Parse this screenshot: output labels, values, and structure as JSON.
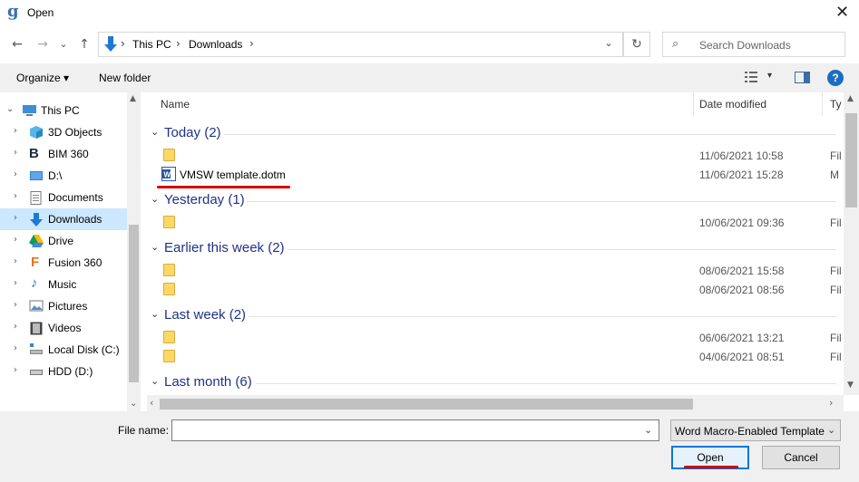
{
  "window": {
    "title": "Open",
    "app_icon": "g",
    "close_glyph": "✕"
  },
  "nav": {
    "back_glyph": "←",
    "forward_glyph": "→",
    "recent_glyph": "⌄",
    "up_glyph": "↑",
    "breadcrumb": [
      "This PC",
      "Downloads"
    ],
    "sep_glyph": "›",
    "dropdown_glyph": "⌄",
    "refresh_glyph": "↻",
    "search_placeholder": "Search Downloads",
    "search_glyph": "⌕"
  },
  "toolbar": {
    "organize": "Organize ▾",
    "new_folder": "New folder",
    "view_dropdown": "▾",
    "help": "?"
  },
  "sidebar": {
    "items": [
      {
        "label": "This PC",
        "icon": "computer-icon",
        "expander": "⌄"
      },
      {
        "label": "3D Objects",
        "icon": "cube-icon",
        "expander": "›"
      },
      {
        "label": "BIM 360",
        "icon": "bim360-icon",
        "expander": "›"
      },
      {
        "label": "D:\\",
        "icon": "drive-icon",
        "expander": "›"
      },
      {
        "label": "Documents",
        "icon": "documents-icon",
        "expander": "›"
      },
      {
        "label": "Downloads",
        "icon": "downloads-icon",
        "expander": "›",
        "selected": true
      },
      {
        "label": "Drive",
        "icon": "google-drive-icon",
        "expander": "›"
      },
      {
        "label": "Fusion 360",
        "icon": "fusion360-icon",
        "expander": "›"
      },
      {
        "label": "Music",
        "icon": "music-icon",
        "expander": "›"
      },
      {
        "label": "Pictures",
        "icon": "pictures-icon",
        "expander": "›"
      },
      {
        "label": "Videos",
        "icon": "videos-icon",
        "expander": "›"
      },
      {
        "label": "Local Disk (C:)",
        "icon": "local-disk-icon",
        "expander": "›"
      },
      {
        "label": "HDD (D:)",
        "icon": "hdd-icon",
        "expander": "›"
      }
    ]
  },
  "columns": {
    "name": "Name",
    "date_modified": "Date modified",
    "type": "Ty"
  },
  "groups": [
    {
      "label": "Today (2)",
      "rows": [
        {
          "name": "",
          "date": "11/06/2021 10:58",
          "type": "Fil",
          "kind": "folder"
        },
        {
          "name": "VMSW template.dotm",
          "date": "11/06/2021 15:28",
          "type": "M",
          "kind": "word"
        }
      ]
    },
    {
      "label": "Yesterday (1)",
      "rows": [
        {
          "name": "",
          "date": "10/06/2021 09:36",
          "type": "Fil",
          "kind": "folder"
        }
      ]
    },
    {
      "label": "Earlier this week (2)",
      "rows": [
        {
          "name": "",
          "date": "08/06/2021 15:58",
          "type": "Fil",
          "kind": "folder"
        },
        {
          "name": "",
          "date": "08/06/2021 08:56",
          "type": "Fil",
          "kind": "folder"
        }
      ]
    },
    {
      "label": "Last week (2)",
      "rows": [
        {
          "name": "",
          "date": "06/06/2021 13:21",
          "type": "Fil",
          "kind": "folder"
        },
        {
          "name": "",
          "date": "04/06/2021 08:51",
          "type": "Fil",
          "kind": "folder"
        }
      ]
    },
    {
      "label": "Last month (6)",
      "rows": []
    }
  ],
  "footer": {
    "file_name_label": "File name:",
    "file_name_value": "",
    "file_type": "Word Macro-Enabled Template",
    "open": "Open",
    "cancel": "Cancel",
    "dropdown_glyph": "⌄"
  },
  "colors": {
    "accent": "#0078d7",
    "selection": "#cce8ff",
    "group_header": "#1e3287",
    "annotation": "#d40000"
  }
}
